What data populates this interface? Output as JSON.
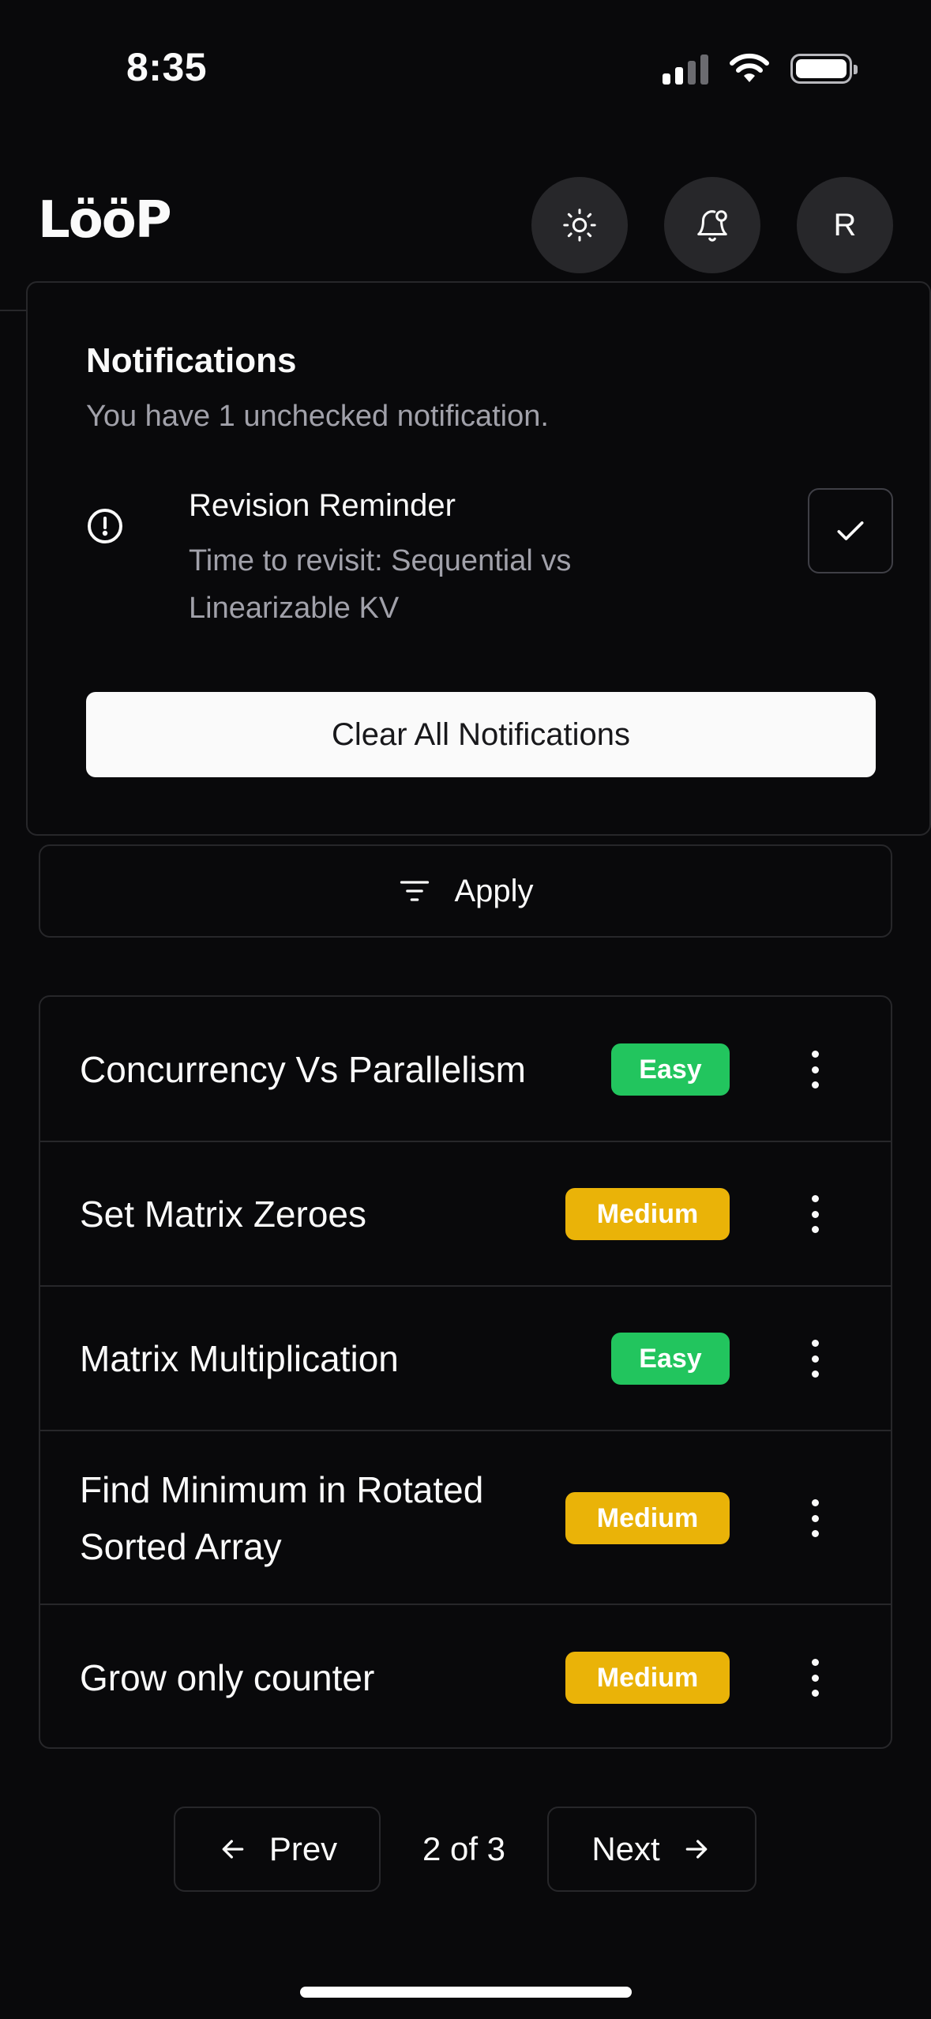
{
  "status_bar": {
    "time": "8:35"
  },
  "header": {
    "logo": "LööP",
    "avatar_initial": "R"
  },
  "notifications": {
    "title": "Notifications",
    "subtitle": "You have 1 unchecked notification.",
    "items": [
      {
        "title": "Revision Reminder",
        "body": "Time to revisit: Sequential vs Linearizable KV"
      }
    ],
    "clear_all_label": "Clear All Notifications"
  },
  "filter": {
    "apply_label": "Apply"
  },
  "problems": [
    {
      "title": "Concurrency Vs Parallelism",
      "difficulty": "Easy"
    },
    {
      "title": "Set Matrix Zeroes",
      "difficulty": "Medium"
    },
    {
      "title": "Matrix Multiplication",
      "difficulty": "Easy"
    },
    {
      "title": "Find Minimum in Rotated Sorted Array",
      "difficulty": "Medium"
    },
    {
      "title": "Grow only counter",
      "difficulty": "Medium"
    }
  ],
  "pagination": {
    "prev_label": "Prev",
    "next_label": "Next",
    "page_text": "2 of 3"
  },
  "colors": {
    "easy": "#22c55e",
    "medium": "#eab308",
    "background": "#09090b",
    "border": "#27272a"
  }
}
